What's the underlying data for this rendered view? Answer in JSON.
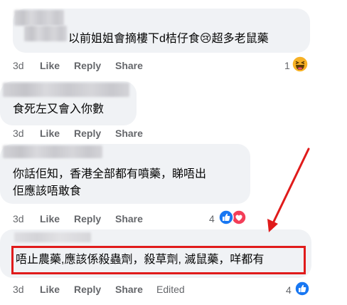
{
  "comments": [
    {
      "text_lines": [
        "以前姐姐會摘樓下d桔仔食😢超多老鼠藥"
      ],
      "time": "3d",
      "actions": [
        "Like",
        "Reply",
        "Share"
      ],
      "reaction_count": "1"
    },
    {
      "text_lines": [
        "食死左又會入你數"
      ],
      "time": "3d",
      "actions": [
        "Like",
        "Reply",
        "Share"
      ]
    },
    {
      "text_lines": [
        "你話佢知，香港全部都有噴藥，睇唔出",
        "佢應該唔敢食"
      ],
      "time": "3d",
      "actions": [
        "Like",
        "Reply",
        "Share"
      ],
      "reaction_count": "4"
    },
    {
      "text_lines": [
        "唔止農藥,應該係殺蟲劑，殺草劑, 滅鼠藥，咩都有"
      ],
      "time": "3d",
      "actions": [
        "Like",
        "Reply",
        "Share",
        "Edited"
      ],
      "reaction_count": "4"
    }
  ],
  "colors": {
    "bubble": "#f0f2f5",
    "action_text": "#65676b",
    "like_blue": "#1877f2",
    "love_red": "#f33e58",
    "haha_yellow": "#f7b125",
    "annotation_red": "#e01b1b"
  },
  "icons": [
    "sad-emoji-icon",
    "haha-reaction-icon",
    "like-reaction-icon",
    "love-reaction-icon",
    "annotation-arrow"
  ]
}
